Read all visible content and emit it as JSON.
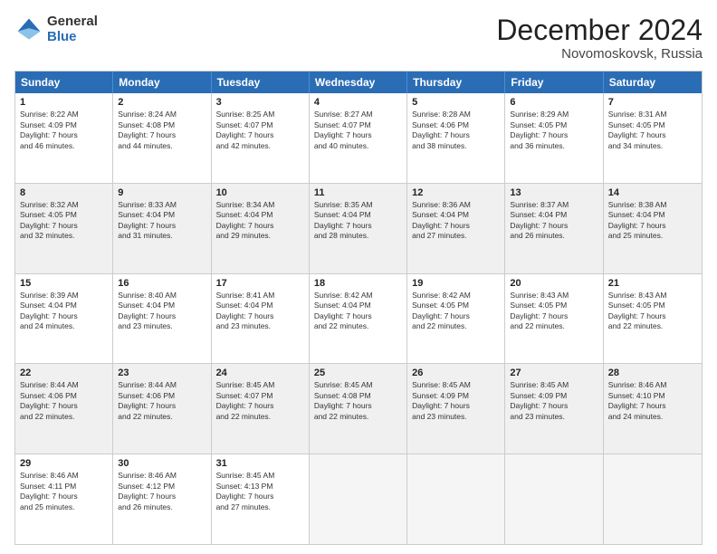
{
  "logo": {
    "general": "General",
    "blue": "Blue"
  },
  "title": "December 2024",
  "subtitle": "Novomoskovsk, Russia",
  "days": [
    "Sunday",
    "Monday",
    "Tuesday",
    "Wednesday",
    "Thursday",
    "Friday",
    "Saturday"
  ],
  "weeks": [
    [
      {
        "day": "1",
        "text": "Sunrise: 8:22 AM\nSunset: 4:09 PM\nDaylight: 7 hours\nand 46 minutes.",
        "shaded": false
      },
      {
        "day": "2",
        "text": "Sunrise: 8:24 AM\nSunset: 4:08 PM\nDaylight: 7 hours\nand 44 minutes.",
        "shaded": false
      },
      {
        "day": "3",
        "text": "Sunrise: 8:25 AM\nSunset: 4:07 PM\nDaylight: 7 hours\nand 42 minutes.",
        "shaded": false
      },
      {
        "day": "4",
        "text": "Sunrise: 8:27 AM\nSunset: 4:07 PM\nDaylight: 7 hours\nand 40 minutes.",
        "shaded": false
      },
      {
        "day": "5",
        "text": "Sunrise: 8:28 AM\nSunset: 4:06 PM\nDaylight: 7 hours\nand 38 minutes.",
        "shaded": false
      },
      {
        "day": "6",
        "text": "Sunrise: 8:29 AM\nSunset: 4:05 PM\nDaylight: 7 hours\nand 36 minutes.",
        "shaded": false
      },
      {
        "day": "7",
        "text": "Sunrise: 8:31 AM\nSunset: 4:05 PM\nDaylight: 7 hours\nand 34 minutes.",
        "shaded": false
      }
    ],
    [
      {
        "day": "8",
        "text": "Sunrise: 8:32 AM\nSunset: 4:05 PM\nDaylight: 7 hours\nand 32 minutes.",
        "shaded": true
      },
      {
        "day": "9",
        "text": "Sunrise: 8:33 AM\nSunset: 4:04 PM\nDaylight: 7 hours\nand 31 minutes.",
        "shaded": true
      },
      {
        "day": "10",
        "text": "Sunrise: 8:34 AM\nSunset: 4:04 PM\nDaylight: 7 hours\nand 29 minutes.",
        "shaded": true
      },
      {
        "day": "11",
        "text": "Sunrise: 8:35 AM\nSunset: 4:04 PM\nDaylight: 7 hours\nand 28 minutes.",
        "shaded": true
      },
      {
        "day": "12",
        "text": "Sunrise: 8:36 AM\nSunset: 4:04 PM\nDaylight: 7 hours\nand 27 minutes.",
        "shaded": true
      },
      {
        "day": "13",
        "text": "Sunrise: 8:37 AM\nSunset: 4:04 PM\nDaylight: 7 hours\nand 26 minutes.",
        "shaded": true
      },
      {
        "day": "14",
        "text": "Sunrise: 8:38 AM\nSunset: 4:04 PM\nDaylight: 7 hours\nand 25 minutes.",
        "shaded": true
      }
    ],
    [
      {
        "day": "15",
        "text": "Sunrise: 8:39 AM\nSunset: 4:04 PM\nDaylight: 7 hours\nand 24 minutes.",
        "shaded": false
      },
      {
        "day": "16",
        "text": "Sunrise: 8:40 AM\nSunset: 4:04 PM\nDaylight: 7 hours\nand 23 minutes.",
        "shaded": false
      },
      {
        "day": "17",
        "text": "Sunrise: 8:41 AM\nSunset: 4:04 PM\nDaylight: 7 hours\nand 23 minutes.",
        "shaded": false
      },
      {
        "day": "18",
        "text": "Sunrise: 8:42 AM\nSunset: 4:04 PM\nDaylight: 7 hours\nand 22 minutes.",
        "shaded": false
      },
      {
        "day": "19",
        "text": "Sunrise: 8:42 AM\nSunset: 4:05 PM\nDaylight: 7 hours\nand 22 minutes.",
        "shaded": false
      },
      {
        "day": "20",
        "text": "Sunrise: 8:43 AM\nSunset: 4:05 PM\nDaylight: 7 hours\nand 22 minutes.",
        "shaded": false
      },
      {
        "day": "21",
        "text": "Sunrise: 8:43 AM\nSunset: 4:05 PM\nDaylight: 7 hours\nand 22 minutes.",
        "shaded": false
      }
    ],
    [
      {
        "day": "22",
        "text": "Sunrise: 8:44 AM\nSunset: 4:06 PM\nDaylight: 7 hours\nand 22 minutes.",
        "shaded": true
      },
      {
        "day": "23",
        "text": "Sunrise: 8:44 AM\nSunset: 4:06 PM\nDaylight: 7 hours\nand 22 minutes.",
        "shaded": true
      },
      {
        "day": "24",
        "text": "Sunrise: 8:45 AM\nSunset: 4:07 PM\nDaylight: 7 hours\nand 22 minutes.",
        "shaded": true
      },
      {
        "day": "25",
        "text": "Sunrise: 8:45 AM\nSunset: 4:08 PM\nDaylight: 7 hours\nand 22 minutes.",
        "shaded": true
      },
      {
        "day": "26",
        "text": "Sunrise: 8:45 AM\nSunset: 4:09 PM\nDaylight: 7 hours\nand 23 minutes.",
        "shaded": true
      },
      {
        "day": "27",
        "text": "Sunrise: 8:45 AM\nSunset: 4:09 PM\nDaylight: 7 hours\nand 23 minutes.",
        "shaded": true
      },
      {
        "day": "28",
        "text": "Sunrise: 8:46 AM\nSunset: 4:10 PM\nDaylight: 7 hours\nand 24 minutes.",
        "shaded": true
      }
    ],
    [
      {
        "day": "29",
        "text": "Sunrise: 8:46 AM\nSunset: 4:11 PM\nDaylight: 7 hours\nand 25 minutes.",
        "shaded": false
      },
      {
        "day": "30",
        "text": "Sunrise: 8:46 AM\nSunset: 4:12 PM\nDaylight: 7 hours\nand 26 minutes.",
        "shaded": false
      },
      {
        "day": "31",
        "text": "Sunrise: 8:45 AM\nSunset: 4:13 PM\nDaylight: 7 hours\nand 27 minutes.",
        "shaded": false
      },
      {
        "day": "",
        "text": "",
        "shaded": false,
        "empty": true
      },
      {
        "day": "",
        "text": "",
        "shaded": false,
        "empty": true
      },
      {
        "day": "",
        "text": "",
        "shaded": false,
        "empty": true
      },
      {
        "day": "",
        "text": "",
        "shaded": false,
        "empty": true
      }
    ]
  ]
}
